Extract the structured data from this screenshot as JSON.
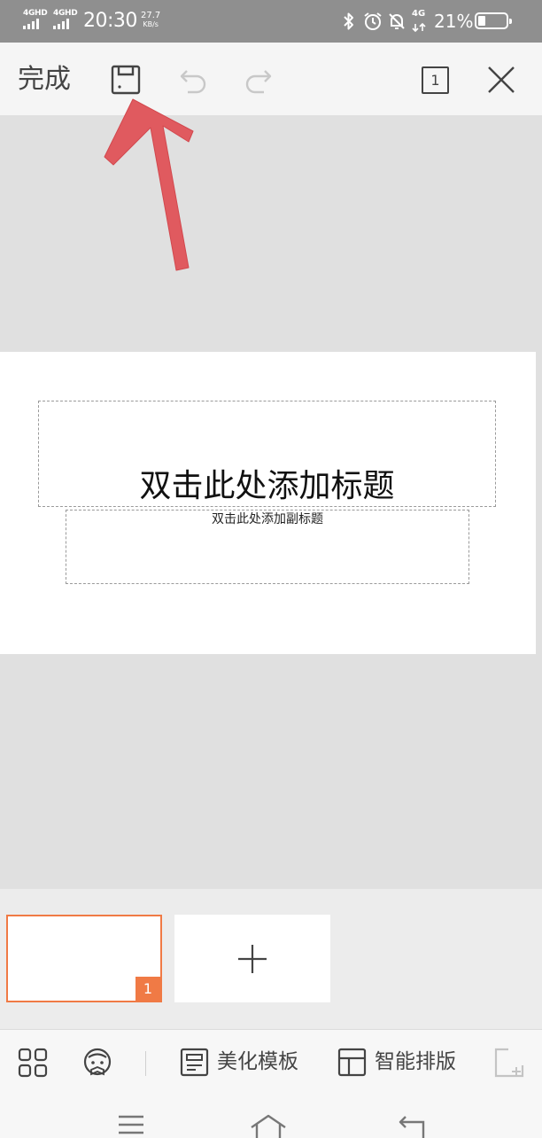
{
  "status_bar": {
    "network_1": "4GHD",
    "network_2": "4GHD",
    "time": "20:30",
    "speed_value": "27.7",
    "speed_unit": "KB/s",
    "network_3": "4G",
    "battery_text": "21%",
    "battery_level": 0.21
  },
  "toolbar": {
    "done_label": "完成",
    "page_count": "1"
  },
  "slide": {
    "title_placeholder": "双击此处添加标题",
    "subtitle_placeholder": "双击此处添加副标题"
  },
  "thumbnails": {
    "items": [
      {
        "number": "1",
        "selected": true
      }
    ],
    "add_symbol": "+"
  },
  "bottom_toolbar": {
    "items": [
      {
        "icon": "layout-grid-icon",
        "label": ""
      },
      {
        "icon": "character-icon",
        "label": ""
      },
      {
        "icon": "template-icon",
        "label": "美化模板"
      },
      {
        "icon": "smart-layout-icon",
        "label": "智能排版"
      },
      {
        "icon": "new-slide-icon",
        "label": ""
      }
    ]
  },
  "colors": {
    "accent": "#f07a45",
    "annotation_arrow": "#e05a5f",
    "status_bar_bg": "#8f8f8f",
    "canvas_bg": "#e0e0e0"
  }
}
